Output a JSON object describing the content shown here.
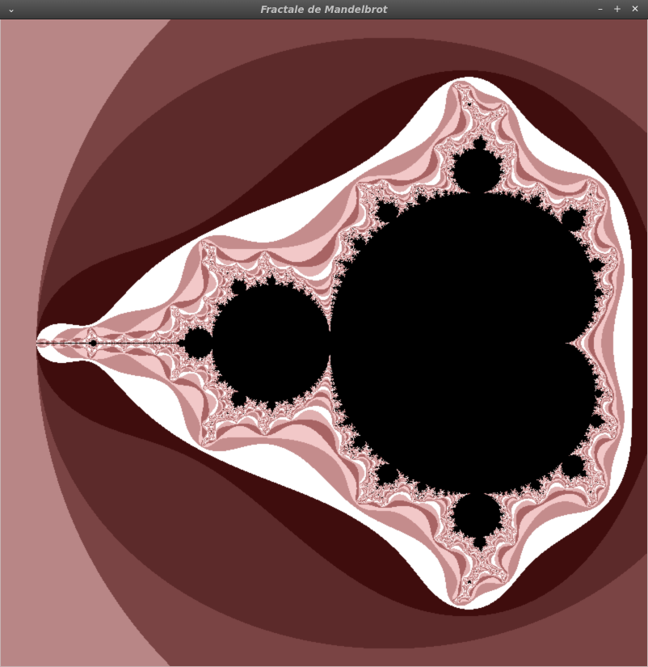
{
  "window": {
    "title": "Fractale de Mandelbrot"
  },
  "titlebar": {
    "menu_icon": "chevron-down-icon",
    "minimize_icon": "minimize-icon",
    "maximize_icon": "maximize-icon",
    "close_icon": "close-icon"
  },
  "fractal": {
    "set": "Mandelbrot",
    "x_range": [
      -2.15,
      0.6
    ],
    "y_range": [
      -1.4,
      1.4
    ],
    "max_iterations": 60,
    "inside_color": "#000000",
    "palette": [
      "#c0908e",
      "#b88686",
      "#7a4444",
      "#5c2a2a",
      "#3f0d0d",
      "#ffffff",
      "#c48c8c",
      "#f2c8c8",
      "#a86464",
      "#e0b0b0",
      "#ffffff"
    ]
  }
}
